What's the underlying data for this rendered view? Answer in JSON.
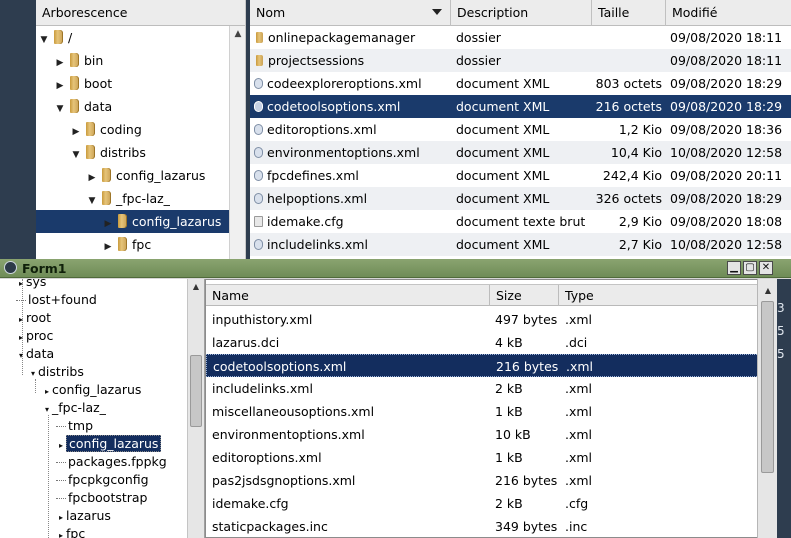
{
  "bg_window": {
    "tree_header": "Arborescence",
    "tree_items": [
      {
        "label": "/",
        "level": 0,
        "expanded": true
      },
      {
        "label": "bin",
        "level": 1,
        "expanded": false
      },
      {
        "label": "boot",
        "level": 1,
        "expanded": false
      },
      {
        "label": "data",
        "level": 1,
        "expanded": true
      },
      {
        "label": "coding",
        "level": 2,
        "expanded": false
      },
      {
        "label": "distribs",
        "level": 2,
        "expanded": true
      },
      {
        "label": "config_lazarus",
        "level": 3,
        "expanded": false
      },
      {
        "label": "_fpc-laz_",
        "level": 3,
        "expanded": true
      },
      {
        "label": "config_lazarus",
        "level": 4,
        "expanded": false,
        "selected": true
      },
      {
        "label": "fpc",
        "level": 4,
        "expanded": false
      }
    ],
    "columns": [
      "Nom",
      "Description",
      "Taille",
      "Modifié"
    ],
    "rows": [
      {
        "name": "onlinepackagemanager",
        "kind": "folder",
        "description": "dossier",
        "size": "",
        "modified": "09/08/2020 18:11"
      },
      {
        "name": "projectsessions",
        "kind": "folder",
        "description": "dossier",
        "size": "",
        "modified": "09/08/2020 18:11"
      },
      {
        "name": "codeexploreroptions.xml",
        "kind": "xml",
        "description": "document XML",
        "size": "803 octets",
        "modified": "09/08/2020 18:29"
      },
      {
        "name": "codetoolsoptions.xml",
        "kind": "xml",
        "description": "document XML",
        "size": "216 octets",
        "modified": "09/08/2020 18:29",
        "selected": true
      },
      {
        "name": "editoroptions.xml",
        "kind": "xml",
        "description": "document XML",
        "size": "1,2 Kio",
        "modified": "09/08/2020 18:36"
      },
      {
        "name": "environmentoptions.xml",
        "kind": "xml",
        "description": "document XML",
        "size": "10,4 Kio",
        "modified": "10/08/2020 12:58"
      },
      {
        "name": "fpcdefines.xml",
        "kind": "xml",
        "description": "document XML",
        "size": "242,4 Kio",
        "modified": "09/08/2020 20:11"
      },
      {
        "name": "helpoptions.xml",
        "kind": "xml",
        "description": "document XML",
        "size": "326 octets",
        "modified": "09/08/2020 18:29"
      },
      {
        "name": "idemake.cfg",
        "kind": "text",
        "description": "document texte brut",
        "size": "2,9 Kio",
        "modified": "09/08/2020 18:08"
      },
      {
        "name": "includelinks.xml",
        "kind": "xml",
        "description": "document XML",
        "size": "2,7 Kio",
        "modified": "10/08/2020 12:58"
      }
    ]
  },
  "form": {
    "title": "Form1",
    "minimize_label": "▁",
    "maximize_label": "▢",
    "close_label": "✕",
    "tree_items": [
      {
        "label": "sys",
        "indent": 1,
        "expander": "▸"
      },
      {
        "label": "lost+found",
        "indent": 1,
        "expander": ""
      },
      {
        "label": "root",
        "indent": 1,
        "expander": "▸"
      },
      {
        "label": "proc",
        "indent": 1,
        "expander": "▸"
      },
      {
        "label": "data",
        "indent": 1,
        "expander": "▾"
      },
      {
        "label": "distribs",
        "indent": 2,
        "expander": "▾"
      },
      {
        "label": "config_lazarus",
        "indent": 3,
        "expander": "▸"
      },
      {
        "label": "_fpc-laz_",
        "indent": 3,
        "expander": "▾"
      },
      {
        "label": "tmp",
        "indent": 4,
        "expander": ""
      },
      {
        "label": "config_lazarus",
        "indent": 4,
        "expander": "▸",
        "selected": true
      },
      {
        "label": "packages.fppkg",
        "indent": 4,
        "expander": ""
      },
      {
        "label": "fpcpkgconfig",
        "indent": 4,
        "expander": ""
      },
      {
        "label": "fpcbootstrap",
        "indent": 4,
        "expander": ""
      },
      {
        "label": "lazarus",
        "indent": 4,
        "expander": "▸"
      },
      {
        "label": "fpc",
        "indent": 4,
        "expander": "▸"
      }
    ],
    "columns": [
      "Name",
      "Size",
      "Type"
    ],
    "rows": [
      {
        "name": "inputhistory.xml",
        "size": "497 bytes",
        "type": ".xml"
      },
      {
        "name": "lazarus.dci",
        "size": "4 kB",
        "type": ".dci"
      },
      {
        "name": "codetoolsoptions.xml",
        "size": "216 bytes",
        "type": ".xml",
        "selected": true
      },
      {
        "name": "includelinks.xml",
        "size": "2 kB",
        "type": ".xml"
      },
      {
        "name": "miscellaneousoptions.xml",
        "size": "1 kB",
        "type": ".xml"
      },
      {
        "name": "environmentoptions.xml",
        "size": "10 kB",
        "type": ".xml"
      },
      {
        "name": "editoroptions.xml",
        "size": "1 kB",
        "type": ".xml"
      },
      {
        "name": "pas2jsdsgnoptions.xml",
        "size": "216 bytes",
        "type": ".xml"
      },
      {
        "name": "idemake.cfg",
        "size": "2 kB",
        "type": ".cfg"
      },
      {
        "name": "staticpackages.inc",
        "size": "349 bytes",
        "type": ".inc"
      }
    ],
    "edge_digits": [
      "3",
      "5",
      "5"
    ]
  },
  "colors": {
    "selection": "#132d5e",
    "titlebar": "#7a9660",
    "desktop": "#2e3d4f"
  }
}
